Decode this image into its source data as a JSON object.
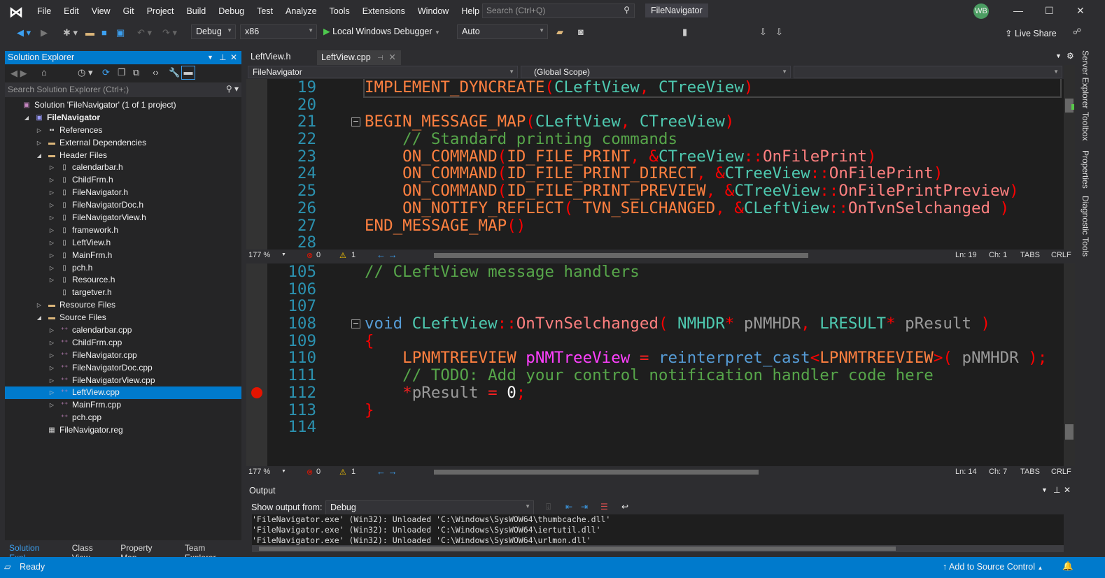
{
  "menu": {
    "logo": "VS",
    "items": [
      "File",
      "Edit",
      "View",
      "Git",
      "Project",
      "Build",
      "Debug",
      "Test",
      "Analyze",
      "Tools",
      "Extensions",
      "Window",
      "Help"
    ],
    "search_placeholder": "Search (Ctrl+Q)",
    "app_title": "FileNavigator",
    "avatar": "WB"
  },
  "toolbar": {
    "config": "Debug",
    "platform": "x86",
    "run_label": "Local Windows Debugger",
    "mode": "Auto",
    "live_share": "Live Share"
  },
  "solution_explorer": {
    "title": "Solution Explorer",
    "search_placeholder": "Search Solution Explorer (Ctrl+;)",
    "tree": [
      {
        "label": "Solution 'FileNavigator' (1 of 1 project)",
        "level": 0,
        "arrow": "",
        "icon": "solution"
      },
      {
        "label": "FileNavigator",
        "level": 1,
        "arrow": "open",
        "icon": "project",
        "bold": true
      },
      {
        "label": "References",
        "level": 2,
        "arrow": "closed",
        "icon": "references"
      },
      {
        "label": "External Dependencies",
        "level": 2,
        "arrow": "closed",
        "icon": "folder"
      },
      {
        "label": "Header Files",
        "level": 2,
        "arrow": "open",
        "icon": "folder"
      },
      {
        "label": "calendarbar.h",
        "level": 3,
        "arrow": "closed",
        "icon": "h"
      },
      {
        "label": "ChildFrm.h",
        "level": 3,
        "arrow": "closed",
        "icon": "h"
      },
      {
        "label": "FileNavigator.h",
        "level": 3,
        "arrow": "closed",
        "icon": "h"
      },
      {
        "label": "FileNavigatorDoc.h",
        "level": 3,
        "arrow": "closed",
        "icon": "h"
      },
      {
        "label": "FileNavigatorView.h",
        "level": 3,
        "arrow": "closed",
        "icon": "h"
      },
      {
        "label": "framework.h",
        "level": 3,
        "arrow": "closed",
        "icon": "h"
      },
      {
        "label": "LeftView.h",
        "level": 3,
        "arrow": "closed",
        "icon": "h"
      },
      {
        "label": "MainFrm.h",
        "level": 3,
        "arrow": "closed",
        "icon": "h"
      },
      {
        "label": "pch.h",
        "level": 3,
        "arrow": "closed",
        "icon": "h"
      },
      {
        "label": "Resource.h",
        "level": 3,
        "arrow": "closed",
        "icon": "h"
      },
      {
        "label": "targetver.h",
        "level": 3,
        "arrow": "",
        "icon": "h"
      },
      {
        "label": "Resource Files",
        "level": 2,
        "arrow": "closed",
        "icon": "folder"
      },
      {
        "label": "Source Files",
        "level": 2,
        "arrow": "open",
        "icon": "folder"
      },
      {
        "label": "calendarbar.cpp",
        "level": 3,
        "arrow": "closed",
        "icon": "cpp"
      },
      {
        "label": "ChildFrm.cpp",
        "level": 3,
        "arrow": "closed",
        "icon": "cpp"
      },
      {
        "label": "FileNavigator.cpp",
        "level": 3,
        "arrow": "closed",
        "icon": "cpp"
      },
      {
        "label": "FileNavigatorDoc.cpp",
        "level": 3,
        "arrow": "closed",
        "icon": "cpp"
      },
      {
        "label": "FileNavigatorView.cpp",
        "level": 3,
        "arrow": "closed",
        "icon": "cpp"
      },
      {
        "label": "LeftView.cpp",
        "level": 3,
        "arrow": "closed",
        "icon": "cpp",
        "selected": true
      },
      {
        "label": "MainFrm.cpp",
        "level": 3,
        "arrow": "closed",
        "icon": "cpp"
      },
      {
        "label": "pch.cpp",
        "level": 3,
        "arrow": "",
        "icon": "cpp"
      },
      {
        "label": "FileNavigator.reg",
        "level": 2,
        "arrow": "",
        "icon": "reg"
      }
    ],
    "bottom_tabs": [
      "Solution Expl...",
      "Class View",
      "Property Man...",
      "Team Explorer"
    ]
  },
  "editor": {
    "tabs": [
      "LeftView.h",
      "LeftView.cpp"
    ],
    "active_tab": 1,
    "nav": {
      "project": "FileNavigator",
      "scope": "(Global Scope)"
    },
    "pane1": {
      "lines": [
        {
          "n": "19",
          "t": [
            [
              "mac",
              "IMPLEMENT_DYNCREATE"
            ],
            [
              "p",
              "("
            ],
            [
              "id",
              "CLeftView"
            ],
            [
              "p",
              ", "
            ],
            [
              "id",
              "CTreeView"
            ],
            [
              "p",
              ")"
            ]
          ]
        },
        {
          "n": "20",
          "t": []
        },
        {
          "n": "21",
          "fold": true,
          "t": [
            [
              "mac",
              "BEGIN_MESSAGE_MAP"
            ],
            [
              "p",
              "("
            ],
            [
              "id",
              "CLeftView"
            ],
            [
              "p",
              ", "
            ],
            [
              "id",
              "CTreeView"
            ],
            [
              "p",
              ")"
            ]
          ]
        },
        {
          "n": "22",
          "t": [
            [
              "cm",
              "    // Standard printing commands"
            ]
          ]
        },
        {
          "n": "23",
          "t": [
            [
              "mac",
              "    ON_COMMAND"
            ],
            [
              "p",
              "("
            ],
            [
              "mac",
              "ID_FILE_PRINT"
            ],
            [
              "p",
              ", &"
            ],
            [
              "id",
              "CTreeView"
            ],
            [
              "p",
              "::"
            ],
            [
              "fn",
              "OnFilePrint"
            ],
            [
              "p",
              ")"
            ]
          ]
        },
        {
          "n": "24",
          "t": [
            [
              "mac",
              "    ON_COMMAND"
            ],
            [
              "p",
              "("
            ],
            [
              "mac",
              "ID_FILE_PRINT_DIRECT"
            ],
            [
              "p",
              ", &"
            ],
            [
              "id",
              "CTreeView"
            ],
            [
              "p",
              "::"
            ],
            [
              "fn",
              "OnFilePrint"
            ],
            [
              "p",
              ")"
            ]
          ]
        },
        {
          "n": "25",
          "t": [
            [
              "mac",
              "    ON_COMMAND"
            ],
            [
              "p",
              "("
            ],
            [
              "mac",
              "ID_FILE_PRINT_PREVIEW"
            ],
            [
              "p",
              ", &"
            ],
            [
              "id",
              "CTreeView"
            ],
            [
              "p",
              "::"
            ],
            [
              "fn",
              "OnFilePrintPreview"
            ],
            [
              "p",
              ")"
            ]
          ]
        },
        {
          "n": "26",
          "t": [
            [
              "mac",
              "    ON_NOTIFY_REFLECT"
            ],
            [
              "p",
              "( "
            ],
            [
              "mac",
              "TVN_SELCHANGED"
            ],
            [
              "p",
              ", &"
            ],
            [
              "id",
              "CLeftView"
            ],
            [
              "p",
              "::"
            ],
            [
              "fn",
              "OnTvnSelchanged"
            ],
            [
              "p",
              " )"
            ]
          ]
        },
        {
          "n": "27",
          "t": [
            [
              "mac",
              "END_MESSAGE_MAP"
            ],
            [
              "p",
              "()"
            ]
          ]
        },
        {
          "n": "28",
          "t": []
        }
      ],
      "status": {
        "zoom": "177 %",
        "errors": "0",
        "warnings": "1",
        "ln": "Ln: 19",
        "ch": "Ch: 1",
        "tabs": "TABS",
        "eol": "CRLF"
      }
    },
    "pane2": {
      "lines": [
        {
          "n": "105",
          "t": [
            [
              "cm",
              "// CLeftView message handlers"
            ]
          ]
        },
        {
          "n": "106",
          "t": []
        },
        {
          "n": "107",
          "t": []
        },
        {
          "n": "108",
          "fold": true,
          "t": [
            [
              "kw",
              "void"
            ],
            [
              "p",
              " "
            ],
            [
              "id",
              "CLeftView"
            ],
            [
              "p",
              "::"
            ],
            [
              "fn",
              "OnTvnSelchanged"
            ],
            [
              "p",
              "( "
            ],
            [
              "id",
              "NMHDR"
            ],
            [
              "p",
              "* "
            ],
            [
              "par",
              "pNMHDR"
            ],
            [
              "p",
              ", "
            ],
            [
              "id",
              "LRESULT"
            ],
            [
              "p",
              "* "
            ],
            [
              "par",
              "pResult"
            ],
            [
              "p",
              " )"
            ]
          ]
        },
        {
          "n": "109",
          "t": [
            [
              "p",
              "{"
            ]
          ]
        },
        {
          "n": "110",
          "t": [
            [
              "mac",
              "    LPNMTREEVIEW "
            ],
            [
              "loc",
              "pNMTreeView"
            ],
            [
              "op",
              " = "
            ],
            [
              "kw",
              "reinterpret_cast"
            ],
            [
              "p",
              "<"
            ],
            [
              "mac",
              "LPNMTREEVIEW"
            ],
            [
              "p",
              ">( "
            ],
            [
              "par",
              "pNMHDR"
            ],
            [
              "p",
              " );"
            ]
          ]
        },
        {
          "n": "111",
          "t": [
            [
              "cm",
              "    // TODO: Add your control notification handler code here"
            ]
          ]
        },
        {
          "n": "112",
          "bp": true,
          "t": [
            [
              "op",
              "    *"
            ],
            [
              "par",
              "pResult"
            ],
            [
              "op",
              " = "
            ],
            [
              "num",
              "0"
            ],
            [
              "p",
              ";"
            ]
          ]
        },
        {
          "n": "113",
          "t": [
            [
              "p",
              "}"
            ]
          ]
        },
        {
          "n": "114",
          "t": []
        }
      ],
      "status": {
        "zoom": "177 %",
        "errors": "0",
        "warnings": "1",
        "ln": "Ln: 14",
        "ch": "Ch: 7",
        "tabs": "TABS",
        "eol": "CRLF"
      }
    }
  },
  "output": {
    "title": "Output",
    "show_from_label": "Show output from:",
    "source": "Debug",
    "lines": [
      "'FileNavigator.exe' (Win32): Unloaded 'C:\\Windows\\SysWOW64\\thumbcache.dll'",
      "'FileNavigator.exe' (Win32): Unloaded 'C:\\Windows\\SysWOW64\\iertutil.dll'",
      "'FileNavigator.exe' (Win32): Unloaded 'C:\\Windows\\SysWOW64\\urlmon.dll'"
    ]
  },
  "side_tabs": [
    "Server Explorer",
    "Toolbox",
    "Properties",
    "Diagnostic Tools"
  ],
  "status": {
    "ready": "Ready",
    "source_control": "Add to Source Control"
  }
}
